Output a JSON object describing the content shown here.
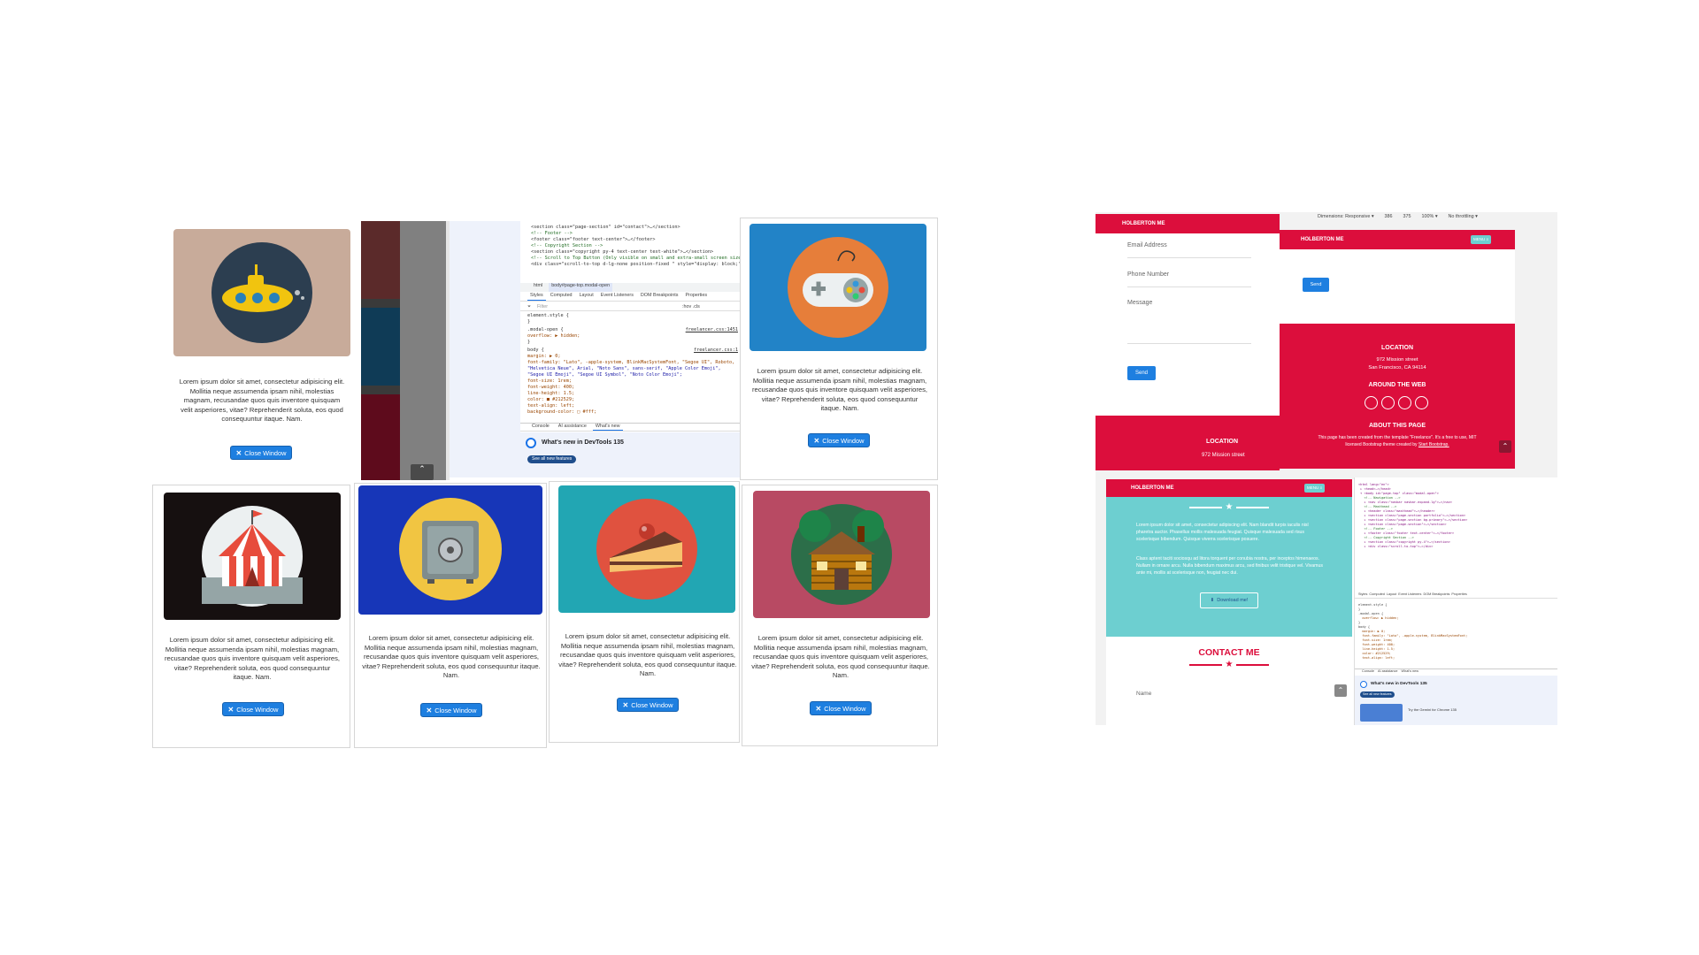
{
  "modal": {
    "body_text": "Lorem ipsum dolor sit amet, consectetur adipisicing elit. Mollitia neque assumenda ipsam nihil, molestias magnam, recusandae quos quis inventore quisquam velit asperiores, vitae? Reprehenderit soluta, eos quod consequuntur itaque. Nam.",
    "close_label": "Close Window"
  },
  "portfolio_icons": [
    "submarine",
    "game-controller",
    "circus-tent",
    "safe",
    "cake-slice",
    "log-cabin"
  ],
  "devtools": {
    "code_lines": [
      "<section class=\"page-section\" id=\"contact\">…</section>",
      "<!-- Footer -->",
      "<footer class=\"footer text-center\">…</footer>",
      "<!-- Copyright Section -->",
      "<section class=\"copyright py-4 text-center text-white\">…</section>",
      "<!-- Scroll to Top Button (Only visible on small and extra-small screen sizes) -->",
      "<div class=\"scroll-to-top d-lg-none position-fixed \" style=\"display: block;\">…</div>"
    ],
    "breadcrumb": [
      "html",
      "body#page-top.modal-open"
    ],
    "tabs": [
      "Styles",
      "Computed",
      "Layout",
      "Event Listeners",
      "DOM Breakpoints",
      "Properties"
    ],
    "filter_placeholder": "Filter",
    "filter_flags": ":hov .cls",
    "rules": [
      {
        "selector": "element.style {",
        "source": ""
      },
      {
        "selector": "}",
        "source": ""
      },
      {
        "selector": ".modal-open {",
        "source": "freelancer.css:1451"
      },
      {
        "selector": "  overflow: ▶ hidden;",
        "source": ""
      },
      {
        "selector": "}",
        "source": ""
      },
      {
        "selector": "body {",
        "source": "freelancer.css:1"
      },
      {
        "selector": "  margin: ▶ 0;",
        "source": ""
      },
      {
        "selector": "  font-family: \"Lato\", -apple-system, BlinkMacSystemFont, \"Segoe UI\", Roboto,",
        "source": ""
      },
      {
        "selector": "    \"Helvetica Neue\", Arial, \"Noto Sans\", sans-serif, \"Apple Color Emoji\",",
        "source": ""
      },
      {
        "selector": "    \"Segoe UI Emoji\", \"Segoe UI Symbol\", \"Noto Color Emoji\";",
        "source": ""
      },
      {
        "selector": "  font-size: 1rem;",
        "source": ""
      },
      {
        "selector": "  font-weight: 400;",
        "source": ""
      },
      {
        "selector": "  line-height: 1.5;",
        "source": ""
      },
      {
        "selector": "  color: ■ #212529;",
        "source": ""
      },
      {
        "selector": "  text-align: left;",
        "source": ""
      },
      {
        "selector": "  background-color: □ #fff;",
        "source": ""
      }
    ],
    "drawer_tabs": [
      "Console",
      "AI assistance",
      "What's new"
    ],
    "whats_new_title": "What's new in DevTools 135",
    "see_all_label": "See all new features"
  },
  "contact_form": {
    "navbar_brand": "HOLBERTON ME",
    "email_label": "Email Address",
    "phone_label": "Phone Number",
    "message_label": "Message",
    "send_label": "Send",
    "footer_location_heading": "LOCATION",
    "footer_address": "972 Mission street"
  },
  "responsive_topbar": {
    "dimensions_label": "Dimensions: Responsive ▾",
    "width": "386",
    "height": "375",
    "zoom": "100% ▾",
    "throttle": "No throttling ▾"
  },
  "mobile_view": {
    "brand": "HOLBERTON ME",
    "menu_label": "MENU ≡",
    "send_label": "Send",
    "location_heading": "LOCATION",
    "address_line1": "972 Mission street",
    "address_line2": "San Francisco, CA 94114",
    "around_web_heading": "AROUND THE WEB",
    "about_heading": "ABOUT THIS PAGE",
    "about_text_line1": "This page has been created from the template \"Freelance\". It's a free to use, MIT",
    "about_text_line2": "licensed Bootstrap theme created by",
    "about_link": "Start Bootstrap."
  },
  "about_view": {
    "brand": "HOLBERTON ME",
    "menu_label": "MENU ≡",
    "para1": "Lorem ipsum dolor sit amet, consectetur adipiscing elit. Nam blandit turpis iaculis nisl pharetra auctor. Phasellus mollis malesuada feugiat. Quisque malesuada sed risus scelerisque bibendum. Quisque viverra scelerisque posuere.",
    "para2": "Class aptent taciti sociosqu ad litora torquent per conubia nostra, per inceptos himenaeos. Nullam in ornare arcu. Nulla bibendum maximus arcu, sed finibus velit tristique vel. Vivamus ante mi, mollis at scelerisque non, feugiat nec dui.",
    "download_label": "Download me!",
    "contact_heading": "CONTACT ME",
    "name_label": "Name"
  },
  "devtools_small": {
    "whats_new_title": "What's new in DevTools 135",
    "see_all_label": "See all new features",
    "promo_text": "Try the Gemini for Chrome 135",
    "tabs": [
      "Styles",
      "Computed",
      "Layout",
      "Event Listeners",
      "DOM Breakpoints",
      "Properties"
    ],
    "drawer_tabs": [
      "Console",
      "AI assistance",
      "What's new"
    ]
  },
  "colors": {
    "accent_blue": "#1e7fe0",
    "brand_red": "#dc0e3c",
    "teal": "#6dcfd0"
  }
}
